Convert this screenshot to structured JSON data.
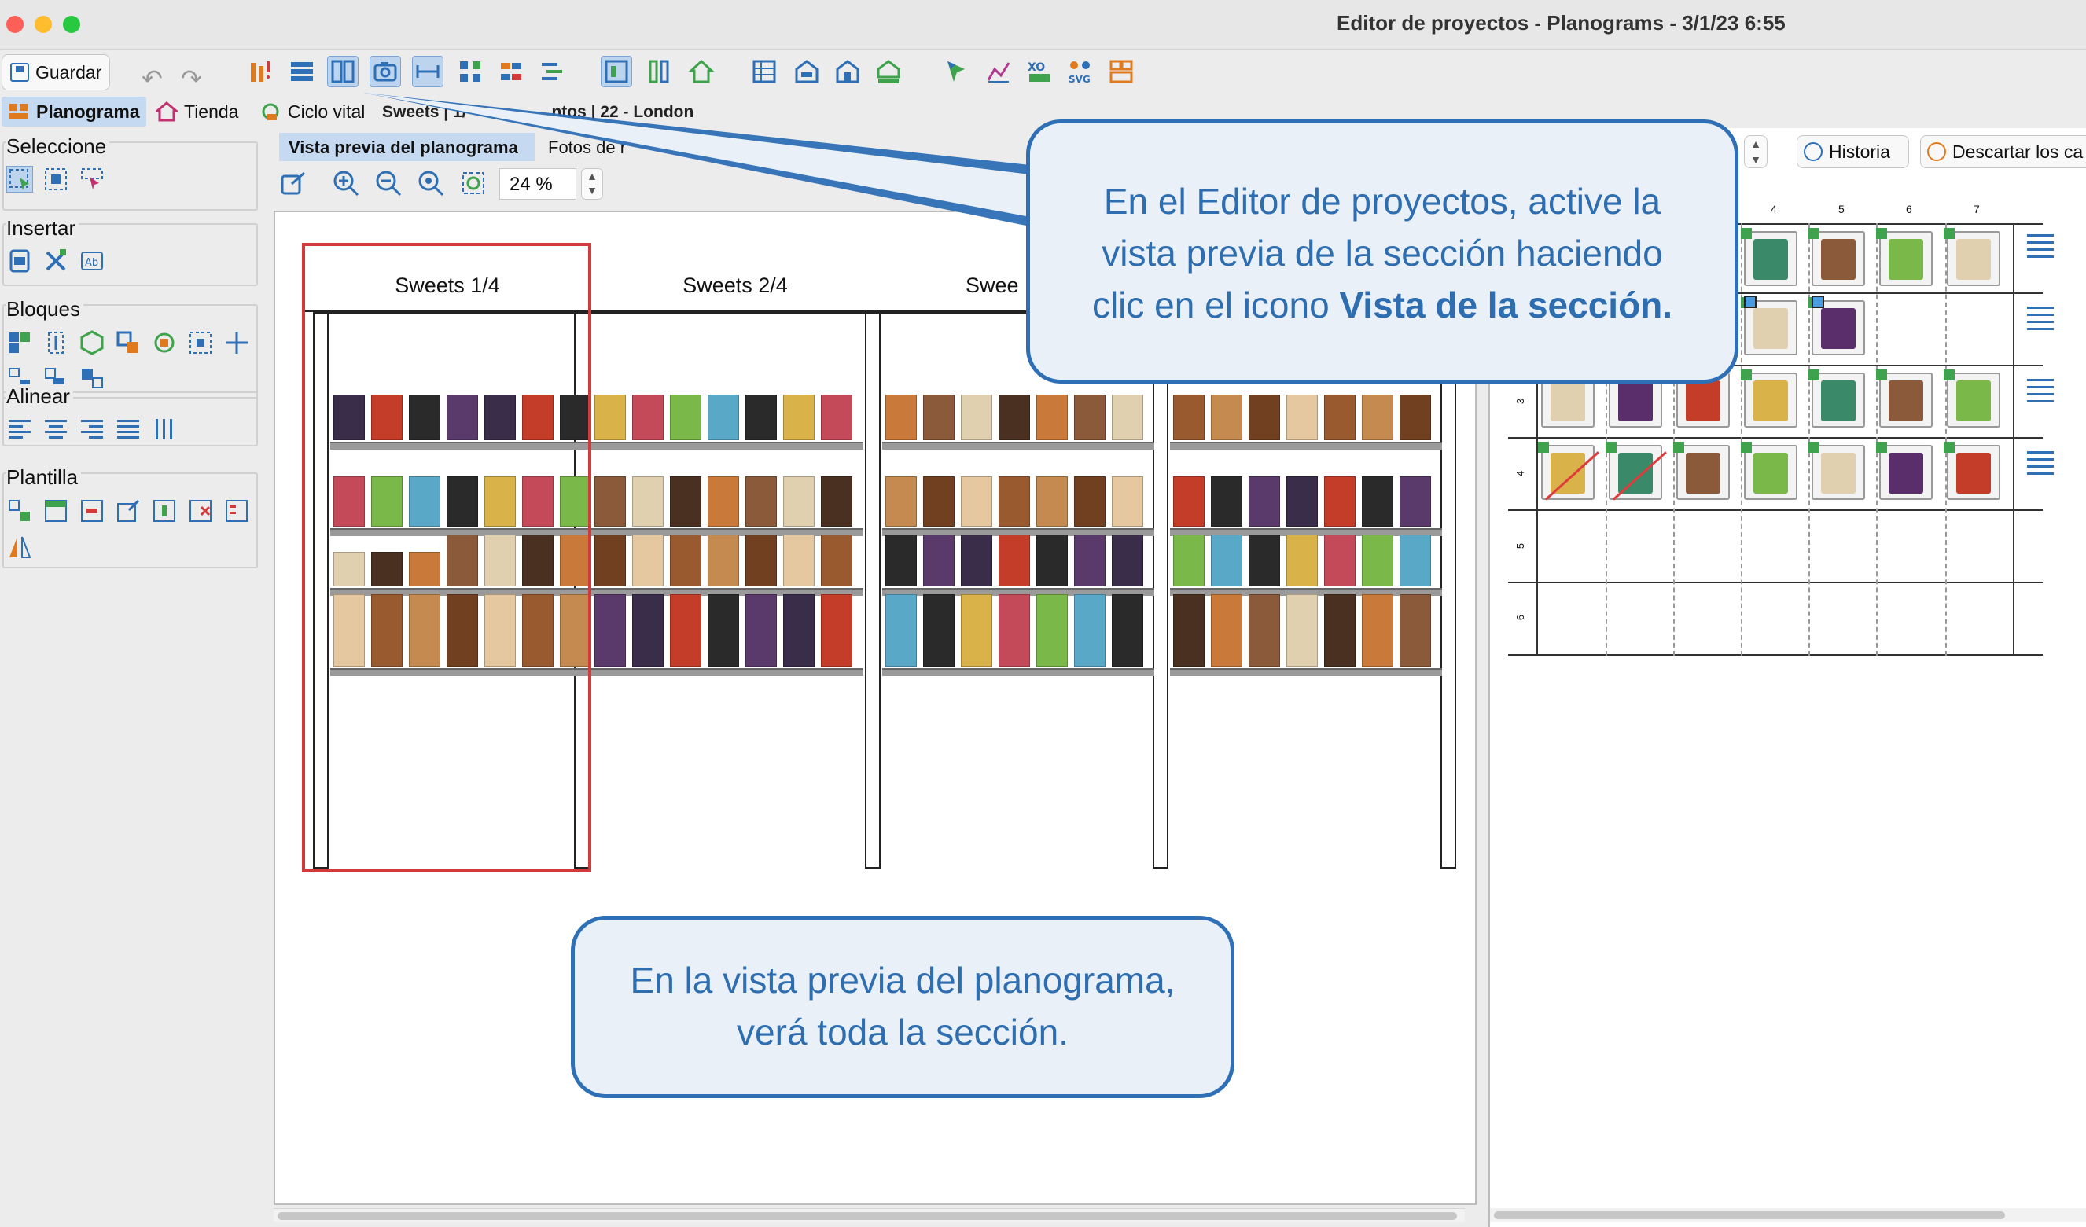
{
  "window": {
    "title": "Editor de proyectos - Planograms - 3/1/23 6:55"
  },
  "toolbar": {
    "save_label": "Guardar",
    "undo_icon": "undo-icon",
    "redo_icon": "redo-icon",
    "section_view_icon": "section-view-icon"
  },
  "tabs": {
    "planograma": "Planograma",
    "tienda": "Tienda",
    "ciclo_vital": "Ciclo vital",
    "breadcrumb": "Sweets | 1/",
    "breadcrumb_tail": "ntos | 22 - London"
  },
  "left_panel": {
    "seleccione": "Seleccione",
    "insertar": "Insertar",
    "bloques": "Bloques",
    "alinear": "Alinear",
    "plantilla": "Plantilla"
  },
  "center": {
    "tab_preview": "Vista previa del planograma",
    "tab_fotos": "Fotos de r",
    "zoom_value": "24 %",
    "sections": [
      "Sweets 1/4",
      "Sweets 2/4",
      "Swee"
    ]
  },
  "right": {
    "historia_label": "Historia",
    "descartar_label": "Descartar los ca",
    "col_numbers": [
      "4",
      "5",
      "6",
      "7"
    ],
    "row_numbers": [
      "3",
      "4",
      "5",
      "6"
    ]
  },
  "callouts": {
    "top_line1": "En el Editor de proyectos, active la",
    "top_line2": "vista previa de la sección haciendo",
    "top_line3_prefix": "clic en el icono ",
    "top_line3_bold": "Vista de la sección.",
    "bottom_line1": "En la vista previa del planograma,",
    "bottom_line2": "verá toda la sección."
  },
  "colors": {
    "accent": "#2e6fb5",
    "callout_bg": "#e9f0f8",
    "selection_red": "#d43a3a",
    "selected_tab": "#c5daf1"
  }
}
